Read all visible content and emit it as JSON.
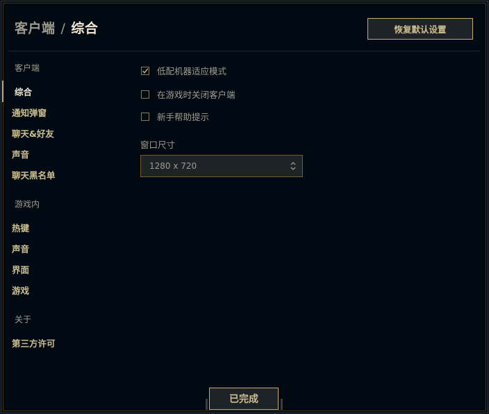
{
  "header": {
    "breadcrumb_root": "客户端",
    "breadcrumb_sep": "/",
    "breadcrumb_current": "综合",
    "restore_button": "恢复默认设置"
  },
  "sidebar": {
    "sections": [
      {
        "heading": "客户端",
        "items": [
          "综合",
          "通知弹窗",
          "聊天&好友",
          "声音",
          "聊天黑名单"
        ]
      },
      {
        "heading": "游戏内",
        "items": [
          "热键",
          "声音",
          "界面",
          "游戏"
        ]
      },
      {
        "heading": "关于",
        "items": [
          "第三方许可"
        ]
      }
    ],
    "active_item": "综合"
  },
  "options": [
    {
      "label": "低配机器适应模式",
      "checked": true
    },
    {
      "label": "在游戏时关闭客户端",
      "checked": false
    },
    {
      "label": "新手帮助提示",
      "checked": false
    }
  ],
  "window_size": {
    "label": "窗口尺寸",
    "value": "1280 x 720"
  },
  "footer": {
    "done_button": "已完成"
  },
  "colors": {
    "background": "#010a13",
    "gold": "#c8aa6e",
    "gold_text": "#cdbe91",
    "muted_text": "#a09b8c",
    "bright_text": "#f0e6d2"
  },
  "icons": {
    "checkmark": "check-icon",
    "select_arrows": "chevron-up-down-icon"
  }
}
